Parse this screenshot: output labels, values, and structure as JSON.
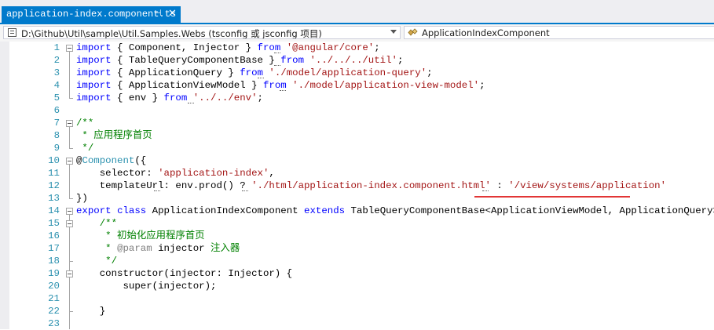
{
  "tab": {
    "title": "application-index.component.ts",
    "pin_glyph": "⊣",
    "close_glyph": "✕"
  },
  "navbar": {
    "project": "D:\\Github\\Util\\sample\\Util.Samples.Webs (tsconfig 或 jsconfig 项目)",
    "scope": "ApplicationIndexComponent"
  },
  "colors": {
    "keyword": "#0000ff",
    "string": "#a31515",
    "comment": "#008000",
    "type": "#2b91af",
    "line_number": "#2b91af",
    "tab_active": "#007acc",
    "highlight_underline": "#e23636"
  },
  "editor": {
    "lines": [
      {
        "n": "1",
        "tokens": [
          [
            "kw",
            "import"
          ],
          [
            "id",
            " { Component, Injector } "
          ],
          [
            "kw",
            "from"
          ],
          [
            "id",
            " "
          ],
          [
            "str",
            "'@angular/core'"
          ],
          [
            "id",
            ";"
          ]
        ]
      },
      {
        "n": "2",
        "tokens": [
          [
            "kw",
            "import"
          ],
          [
            "id",
            " { TableQueryComponentBase } "
          ],
          [
            "kw",
            "from"
          ],
          [
            "id",
            " "
          ],
          [
            "str",
            "'../../../util'"
          ],
          [
            "id",
            ";"
          ]
        ]
      },
      {
        "n": "3",
        "tokens": [
          [
            "kw",
            "import"
          ],
          [
            "id",
            " { ApplicationQuery } "
          ],
          [
            "kw",
            "from"
          ],
          [
            "id",
            " "
          ],
          [
            "str",
            "'./model/application-query'"
          ],
          [
            "id",
            ";"
          ]
        ]
      },
      {
        "n": "4",
        "tokens": [
          [
            "kw",
            "import"
          ],
          [
            "id",
            " { ApplicationViewModel } "
          ],
          [
            "kw",
            "from"
          ],
          [
            "id",
            " "
          ],
          [
            "str",
            "'./model/application-view-model'"
          ],
          [
            "id",
            ";"
          ]
        ]
      },
      {
        "n": "5",
        "tokens": [
          [
            "kw",
            "import"
          ],
          [
            "id",
            " { env } "
          ],
          [
            "kw",
            "from"
          ],
          [
            "id",
            " "
          ],
          [
            "str",
            "'../../env'"
          ],
          [
            "id",
            ";"
          ]
        ]
      },
      {
        "n": "6",
        "tokens": []
      },
      {
        "n": "7",
        "tokens": [
          [
            "cmt",
            "/**"
          ]
        ]
      },
      {
        "n": "8",
        "tokens": [
          [
            "cmt",
            " * 应用程序首页"
          ]
        ]
      },
      {
        "n": "9",
        "tokens": [
          [
            "cmt",
            " */"
          ]
        ]
      },
      {
        "n": "10",
        "tokens": [
          [
            "id",
            "@"
          ],
          [
            "ty",
            "Component"
          ],
          [
            "id",
            "({"
          ]
        ]
      },
      {
        "n": "11",
        "tokens": [
          [
            "id",
            "    selector: "
          ],
          [
            "str",
            "'application-index'"
          ],
          [
            "id",
            ","
          ]
        ]
      },
      {
        "n": "12",
        "tokens": [
          [
            "id",
            "    templateUrl: env.prod() ? "
          ],
          [
            "str",
            "'./html/application-index.component.html'"
          ],
          [
            "id",
            " : "
          ],
          [
            "str",
            "'/view/systems/application'"
          ]
        ]
      },
      {
        "n": "13",
        "tokens": [
          [
            "id",
            "})"
          ]
        ]
      },
      {
        "n": "14",
        "tokens": [
          [
            "kw",
            "export"
          ],
          [
            "id",
            " "
          ],
          [
            "kw",
            "class"
          ],
          [
            "id",
            " ApplicationIndexComponent "
          ],
          [
            "kw",
            "extends"
          ],
          [
            "id",
            " TableQueryComponentBase<ApplicationViewModel, ApplicationQuery>  {"
          ]
        ]
      },
      {
        "n": "15",
        "tokens": [
          [
            "cmt",
            "    /**"
          ]
        ]
      },
      {
        "n": "16",
        "tokens": [
          [
            "cmt",
            "     * 初始化应用程序首页"
          ]
        ]
      },
      {
        "n": "17",
        "tokens": [
          [
            "cmt",
            "     * "
          ],
          [
            "tag",
            "@param"
          ],
          [
            "id",
            " injector "
          ],
          [
            "cmt",
            "注入器"
          ]
        ]
      },
      {
        "n": "18",
        "tokens": [
          [
            "cmt",
            "     */"
          ]
        ]
      },
      {
        "n": "19",
        "tokens": [
          [
            "id",
            "    constructor(injector: Injector) {"
          ]
        ]
      },
      {
        "n": "20",
        "tokens": [
          [
            "id",
            "        super(injector);"
          ]
        ]
      },
      {
        "n": "21",
        "tokens": []
      },
      {
        "n": "22",
        "tokens": [
          [
            "id",
            "    }"
          ]
        ]
      },
      {
        "n": "23",
        "tokens": []
      }
    ]
  }
}
